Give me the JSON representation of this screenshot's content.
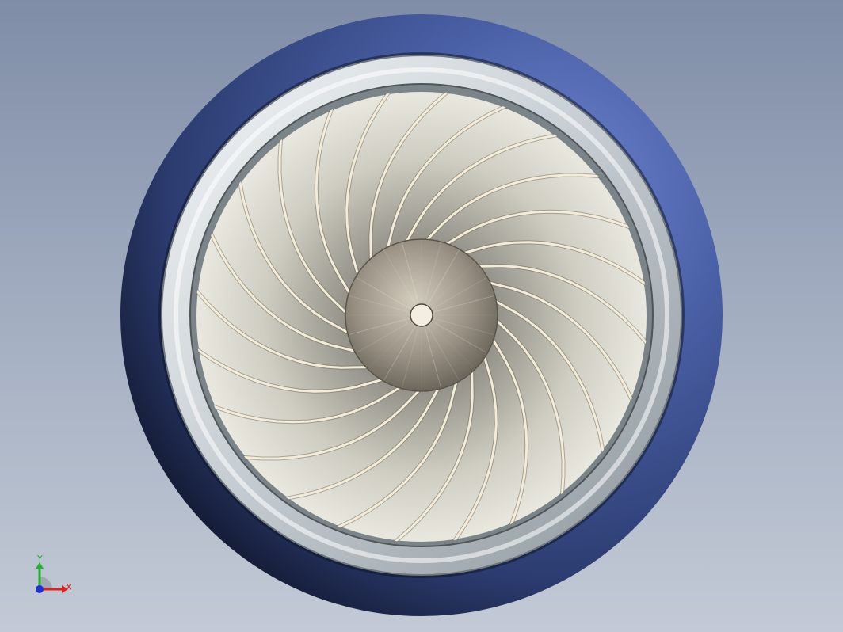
{
  "viewport": {
    "background_top": "#7f8da7",
    "background_bottom": "#c3cad6"
  },
  "model": {
    "nacelle_color": "#34477e",
    "lip_ring_color": "#d3d9dc",
    "blade_color": "#c9c7bb",
    "blade_edge_color": "#f4ecd8",
    "spinner_color": "#9e978b",
    "blade_count": 24
  },
  "triad": {
    "x_label": "X",
    "y_label": "Y",
    "x_color": "#e0201b",
    "y_color": "#1fb52c",
    "z_color": "#1f2fd8"
  }
}
